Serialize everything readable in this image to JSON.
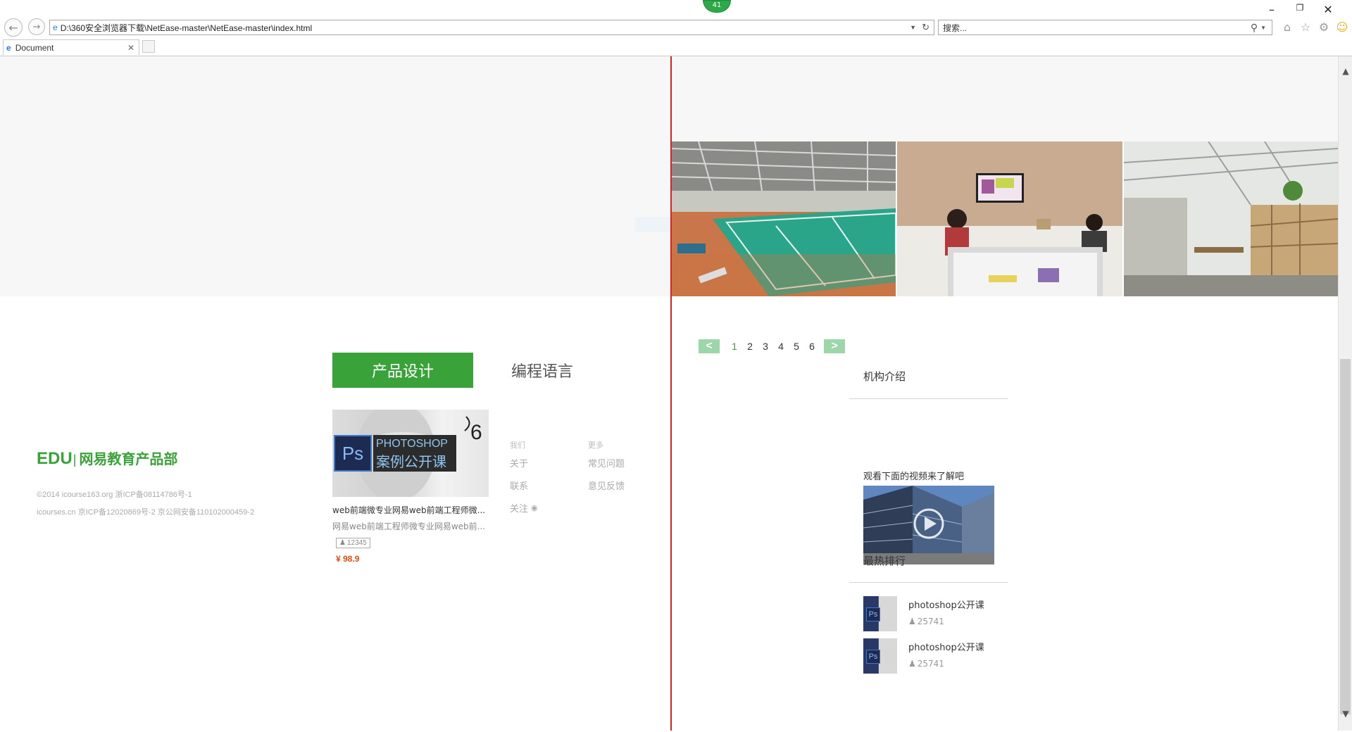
{
  "browser": {
    "address": "D:\\360安全浏览器下载\\NetEase-master\\NetEase-master\\index.html",
    "search_placeholder": "搜索...",
    "tab_title": "Document",
    "badge_count": "41"
  },
  "slider": {
    "pages": [
      "1",
      "2",
      "3",
      "4",
      "5",
      "6"
    ],
    "prev_label": "<",
    "next_label": ">",
    "active_page": "1"
  },
  "tabs": {
    "design": "产品设计",
    "code": "编程语言"
  },
  "course": {
    "img_en": "PHOTOSHOP",
    "img_cn": "案例公开课",
    "img_ps": "Ps",
    "name": "web前端微专业网易web前端工程师微...",
    "desc": "网易web前端工程师微专业网易web前...",
    "learners": "12345",
    "price": "¥ 98.9"
  },
  "footer": {
    "brand": "EDU",
    "brand_sub": "网易教育产品部",
    "line1": "©2014 icourse163.org 浙ICP备08114786号-1",
    "line2": "icourses.cn 京ICP备12020869号-2 京公网安备110102000459-2",
    "col1": {
      "head": "我们",
      "items": [
        "关于",
        "联系",
        "关注"
      ]
    },
    "col2": {
      "head": "更多",
      "items": [
        "常见问题",
        "意见反馈"
      ]
    }
  },
  "sidebar": {
    "intro_title": "机构介绍",
    "video_caption": "观看下面的视频来了解吧",
    "hot_title": "最热排行",
    "rank": [
      {
        "title": "photoshop公开课",
        "count": "25741",
        "ps": "Ps"
      },
      {
        "title": "photoshop公开课",
        "count": "25741",
        "ps": "Ps"
      }
    ]
  },
  "colors": {
    "accent": "#39a239",
    "price": "#e34a14",
    "divider": "#e02020"
  }
}
